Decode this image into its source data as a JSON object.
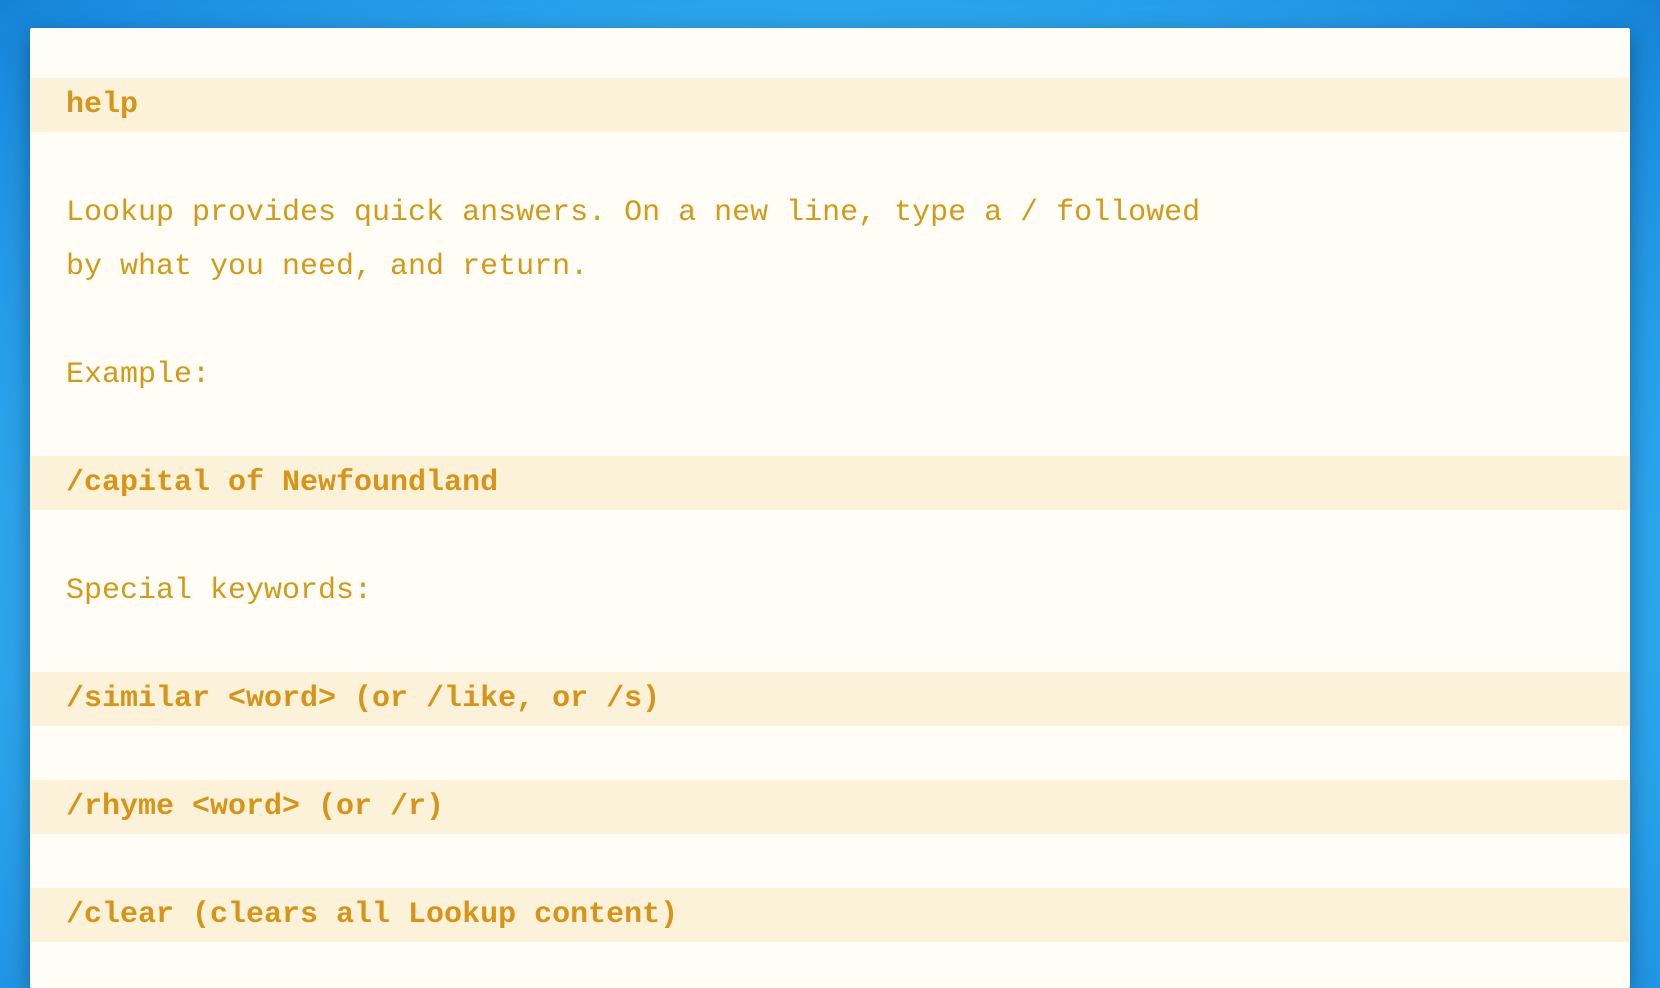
{
  "help": {
    "heading": "help",
    "intro_line1": "Lookup provides quick answers. On a new line, type a / followed",
    "intro_line2": "by what you need, and return.",
    "example_label": "Example:",
    "example_command": "/capital of Newfoundland",
    "special_label": "Special keywords:",
    "commands": {
      "similar": "/similar <word> (or /like, or /s)",
      "rhyme": "/rhyme <word> (or /r)",
      "clear": "/clear (clears all Lookup content)"
    }
  }
}
